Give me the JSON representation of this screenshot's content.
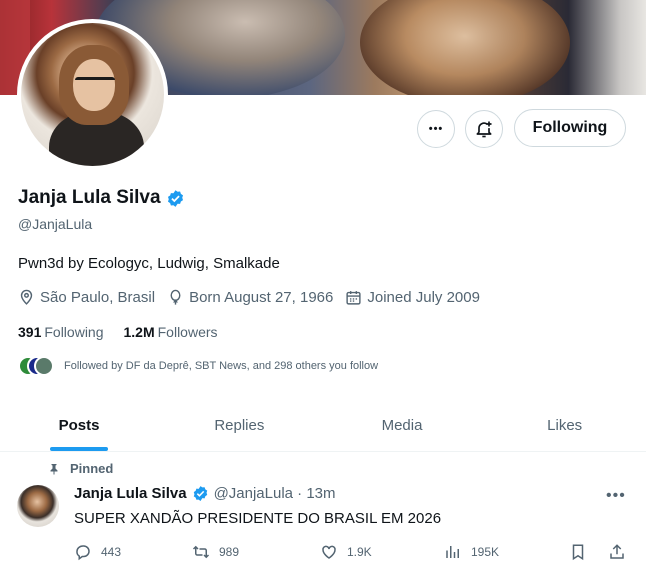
{
  "profile": {
    "name": "Janja Lula Silva",
    "handle": "@JanjaLula",
    "bio": "Pwn3d by Ecologyc, Ludwig, Smalkade",
    "location": "São Paulo, Brasil",
    "birthday": "Born August 27, 1966",
    "joined": "Joined July 2009",
    "following_count": "391",
    "following_label": "Following",
    "followers_count": "1.2M",
    "followers_label": "Followers",
    "followed_by": "Followed by DF da Deprê, SBT News, and 298 others you follow"
  },
  "actions": {
    "more_label": "•••",
    "follow_label": "Following"
  },
  "tabs": [
    {
      "label": "Posts",
      "active": true
    },
    {
      "label": "Replies",
      "active": false
    },
    {
      "label": "Media",
      "active": false
    },
    {
      "label": "Likes",
      "active": false
    }
  ],
  "pinned_post": {
    "pinned_label": "Pinned",
    "author": "Janja Lula Silva",
    "handle_time": "@JanjaLula · 13m",
    "text": "SUPER XANDÃO PRESIDENTE DO BRASIL EM 2026",
    "more_label": "•••",
    "replies": "443",
    "reposts": "989",
    "likes": "1.9K",
    "views": "195K"
  },
  "colors": {
    "accent": "#1d9bf0",
    "text": "#0f1419",
    "secondary": "#536471",
    "border": "#cfd9de"
  },
  "icons": [
    "more-icon",
    "notification-add-icon",
    "verified-icon",
    "location-icon",
    "balloon-icon",
    "calendar-icon",
    "pin-icon",
    "reply-icon",
    "repost-icon",
    "like-icon",
    "views-icon",
    "bookmark-icon",
    "share-icon"
  ]
}
